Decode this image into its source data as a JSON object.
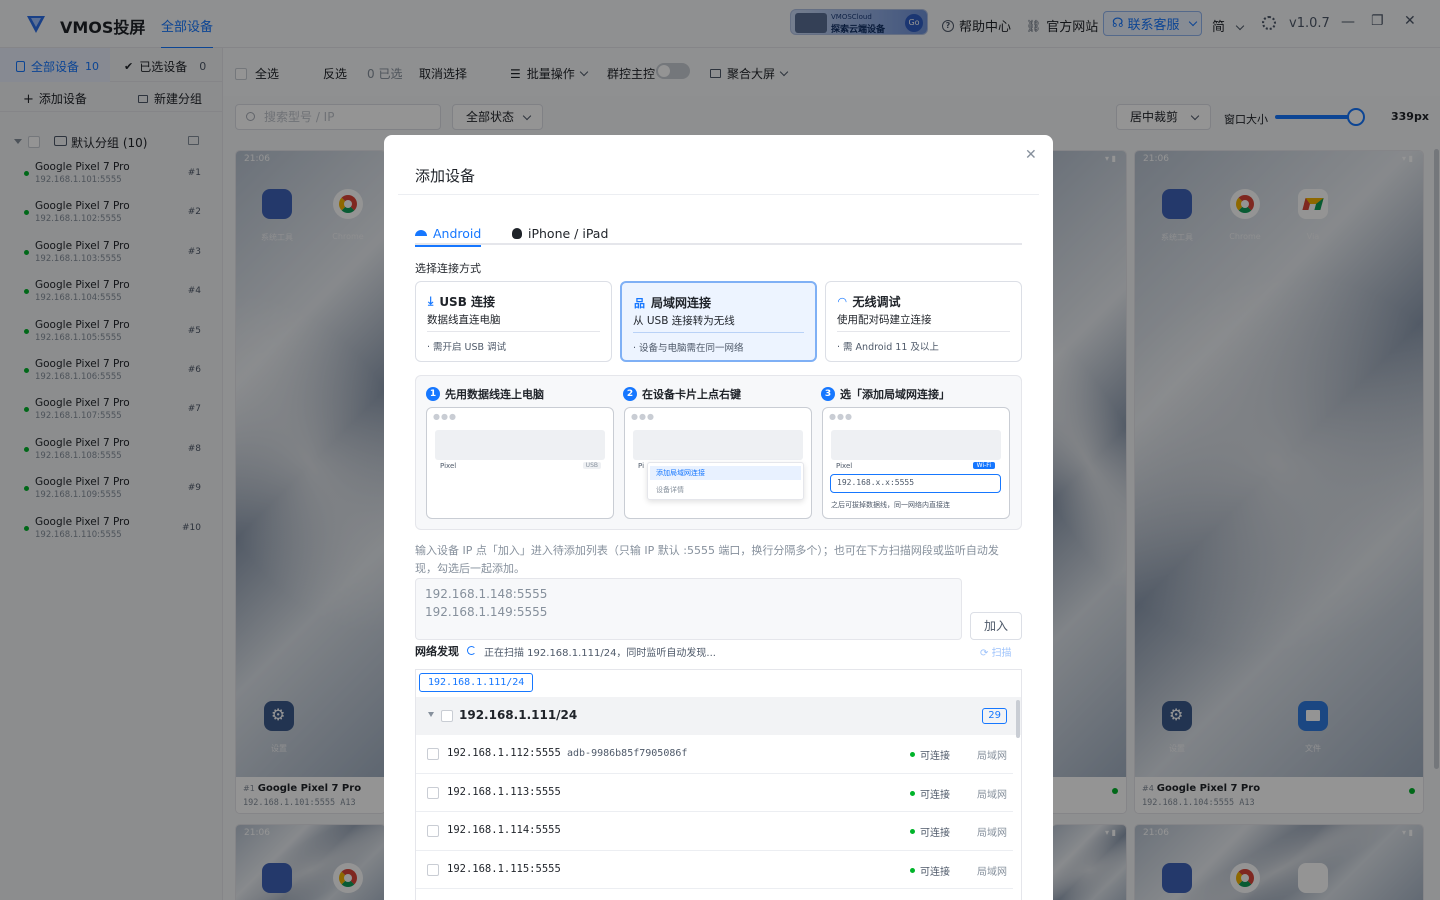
{
  "app": {
    "name": "VMOS投屏",
    "tab": "全部设备",
    "version": "v1.0.7",
    "lang": "简"
  },
  "banner": {
    "line1": "VMOSCloud",
    "line2": "探索云端设备",
    "go": "Go"
  },
  "header": {
    "help": "帮助中心",
    "site": "官方网站",
    "support": "联系客服"
  },
  "sidebar": {
    "tab_all": "全部设备",
    "tab_all_count": "10",
    "tab_selected": "已选设备",
    "tab_selected_count": "0",
    "add_device": "添加设备",
    "new_group": "新建分组",
    "group_name": "默认分组 (10)",
    "devices": [
      {
        "name": "Google Pixel 7 Pro",
        "ip": "192.168.1.101:5555",
        "num": "#1"
      },
      {
        "name": "Google Pixel 7 Pro",
        "ip": "192.168.1.102:5555",
        "num": "#2"
      },
      {
        "name": "Google Pixel 7 Pro",
        "ip": "192.168.1.103:5555",
        "num": "#3"
      },
      {
        "name": "Google Pixel 7 Pro",
        "ip": "192.168.1.104:5555",
        "num": "#4"
      },
      {
        "name": "Google Pixel 7 Pro",
        "ip": "192.168.1.105:5555",
        "num": "#5"
      },
      {
        "name": "Google Pixel 7 Pro",
        "ip": "192.168.1.106:5555",
        "num": "#6"
      },
      {
        "name": "Google Pixel 7 Pro",
        "ip": "192.168.1.107:5555",
        "num": "#7"
      },
      {
        "name": "Google Pixel 7 Pro",
        "ip": "192.168.1.108:5555",
        "num": "#8"
      },
      {
        "name": "Google Pixel 7 Pro",
        "ip": "192.168.1.109:5555",
        "num": "#9"
      },
      {
        "name": "Google Pixel 7 Pro",
        "ip": "192.168.1.110:5555",
        "num": "#10"
      }
    ]
  },
  "toolbar": {
    "select_all": "全选",
    "invert": "反选",
    "selected_count": "0 已选",
    "cancel": "取消选择",
    "batch": "批量操作",
    "group_control": "群控主控",
    "aggregate": "聚合大屏"
  },
  "filter": {
    "search_placeholder": "搜索型号 / IP",
    "status": "全部状态",
    "crop": "居中裁剪",
    "window_size": "窗口大小",
    "size_value": "339px"
  },
  "cards": [
    {
      "time": "21:06",
      "num": "#1",
      "name": "Google Pixel 7 Pro",
      "ip": "192.168.1.101:5555 A13",
      "app1": "系统工具",
      "app2": "Chrome",
      "app3": "设置"
    },
    {
      "time": "21:06",
      "num": "#4",
      "name": "Google Pixel 7 Pro",
      "ip": "192.168.1.104:5555 A13",
      "app1": "系统工具",
      "app2": "Chrome",
      "app2b": "Via",
      "app3": "设置",
      "app4": "文件"
    },
    {
      "time": "21:06"
    },
    {
      "time": "21:06"
    }
  ],
  "modal": {
    "title": "添加设备",
    "tab_android": "Android",
    "tab_ios": "iPhone / iPad",
    "method_label": "选择连接方式",
    "options": [
      {
        "title": "USB 连接",
        "desc": "数据线直连电脑",
        "note": "· 需开启 USB 调试"
      },
      {
        "title": "局域网连接",
        "desc": "从 USB 连接转为无线",
        "note": "· 设备与电脑需在同一网络"
      },
      {
        "title": "无线调试",
        "desc": "使用配对码建立连接",
        "note": "· 需 Android 11 及以上"
      }
    ],
    "steps": [
      {
        "n": "1",
        "title": "先用数据线连上电脑"
      },
      {
        "n": "2",
        "title": "在设备卡片上点右键"
      },
      {
        "n": "3",
        "title": "选「添加局域网连接」"
      }
    ],
    "mock": {
      "pixel": "Pixel",
      "usb": "USB",
      "ctx1": "添加局域网连接",
      "ctx2": "设备详情",
      "wifi": "Wi-Fi",
      "ip_input": "192.168.x.x:5555",
      "note": "之后可拔掉数据线，同一网络内直接连"
    },
    "desc": "输入设备 IP 点「加入」进入待添加列表（只输 IP 默认 :5555 端口，换行分隔多个）；也可在下方扫描网段或监听自动发现，勾选后一起添加。",
    "textarea_line1": "192.168.1.148:5555",
    "textarea_line2": "192.168.1.149:5555",
    "add_btn": "加入",
    "discovery": "网络发现",
    "scan_msg": "正在扫描 192.168.1.111/24，同时监听自动发现...",
    "scan_btn": "扫描",
    "subnet_chip": "192.168.1.111/24",
    "subnet_header": "192.168.1.111/24",
    "subnet_count": "29",
    "rows": [
      {
        "ip": "192.168.1.112:5555",
        "adb": "adb-9986b85f7905086f",
        "status": "可连接",
        "type": "局域网"
      },
      {
        "ip": "192.168.1.113:5555",
        "adb": "",
        "status": "可连接",
        "type": "局域网"
      },
      {
        "ip": "192.168.1.114:5555",
        "adb": "",
        "status": "可连接",
        "type": "局域网"
      },
      {
        "ip": "192.168.1.115:5555",
        "adb": "",
        "status": "可连接",
        "type": "局域网"
      }
    ]
  }
}
